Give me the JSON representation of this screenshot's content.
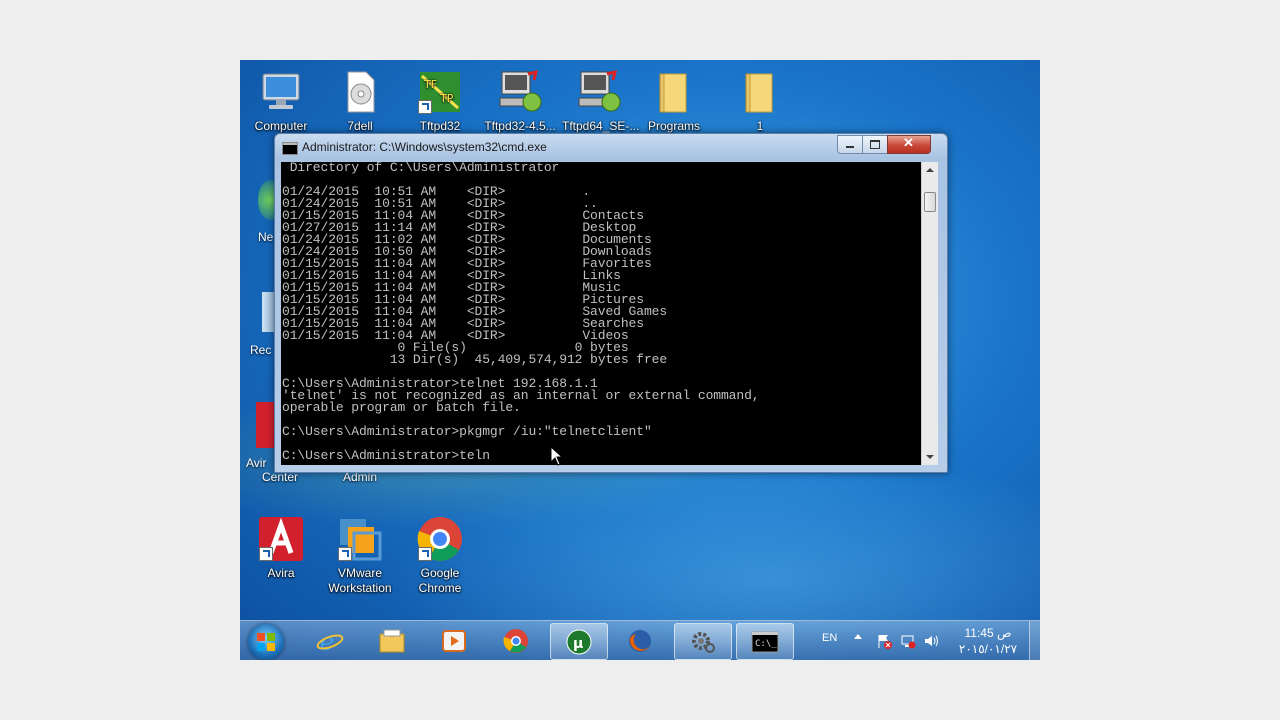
{
  "desktop": {
    "icons_top": [
      {
        "label": "Computer",
        "icon": "computer-icon"
      },
      {
        "label": "7dell",
        "icon": "disc-file-icon"
      },
      {
        "label": "Tftpd32",
        "icon": "tftp-icon"
      },
      {
        "label": "Tftpd32-4.5...",
        "icon": "network-computer-icon"
      },
      {
        "label": "Tftpd64_SE-...",
        "icon": "network-computer-icon"
      },
      {
        "label": "Programs",
        "icon": "folder-icon"
      },
      {
        "label": "1",
        "icon": "folder-icon"
      }
    ],
    "icons_bottom": [
      {
        "label": "Avira",
        "icon": "avira-icon"
      },
      {
        "label": "VMware Workstation",
        "icon": "vmware-icon"
      },
      {
        "label": "Google Chrome",
        "icon": "chrome-icon"
      }
    ],
    "partial_labels": {
      "network": "Ne",
      "recycle": "Rec",
      "avira_center_top": "Avir",
      "avira_center_bottom": "Center",
      "admin": "Admin"
    }
  },
  "cmd": {
    "title": "Administrator: C:\\Windows\\system32\\cmd.exe",
    "lines": [
      " Directory of C:\\Users\\Administrator",
      "",
      "01/24/2015  10:51 AM    <DIR>          .",
      "01/24/2015  10:51 AM    <DIR>          ..",
      "01/15/2015  11:04 AM    <DIR>          Contacts",
      "01/27/2015  11:14 AM    <DIR>          Desktop",
      "01/24/2015  11:02 AM    <DIR>          Documents",
      "01/24/2015  10:50 AM    <DIR>          Downloads",
      "01/15/2015  11:04 AM    <DIR>          Favorites",
      "01/15/2015  11:04 AM    <DIR>          Links",
      "01/15/2015  11:04 AM    <DIR>          Music",
      "01/15/2015  11:04 AM    <DIR>          Pictures",
      "01/15/2015  11:04 AM    <DIR>          Saved Games",
      "01/15/2015  11:04 AM    <DIR>          Searches",
      "01/15/2015  11:04 AM    <DIR>          Videos",
      "               0 File(s)              0 bytes",
      "              13 Dir(s)  45,409,574,912 bytes free",
      "",
      "C:\\Users\\Administrator>telnet 192.168.1.1",
      "'telnet' is not recognized as an internal or external command,",
      "operable program or batch file.",
      "",
      "C:\\Users\\Administrator>pkgmgr /iu:\"telnetclient\"",
      "",
      "C:\\Users\\Administrator>teln"
    ]
  },
  "taskbar": {
    "apps": [
      "ie-icon",
      "explorer-icon",
      "media-player-icon",
      "chrome-icon",
      "utorrent-icon",
      "firefox-icon",
      "settings-icon",
      "cmd-icon"
    ],
    "language": "EN",
    "time": "ص 11:45",
    "date": "٢٠١٥/٠١/٢٧"
  },
  "colors": {
    "console_bg": "#000000",
    "console_fg": "#c0c0c0",
    "desktop_blue": "#1a74c9"
  }
}
